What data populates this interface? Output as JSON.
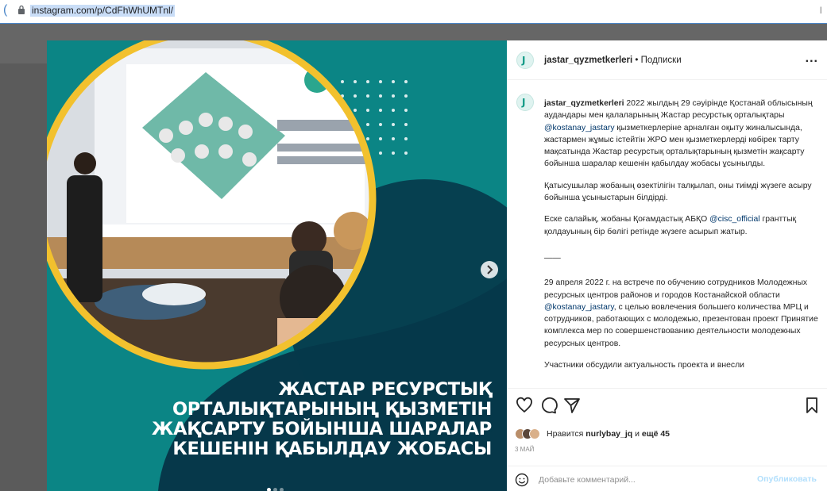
{
  "browser": {
    "url": "instagram.com/p/CdFhWhUMTnl/",
    "right_glyph": "I"
  },
  "post": {
    "author": "jastar_qyzmetkerleri",
    "separator": " • ",
    "follow_status": "Подписки",
    "more_label": "...",
    "headline_lines": [
      "ЖАСТАР РЕСУРСТЫҚ",
      "ОРТАЛЫҚТАРЫНЫҢ ҚЫЗМЕТІН",
      "ЖАҚСАРТУ БОЙЫНША ШАРАЛАР",
      "КЕШЕНІН ҚАБЫЛДАУ ЖОБАСЫ"
    ],
    "slide_dots": 3,
    "active_slide": 1,
    "caption": {
      "p1_text": " 2022 жылдың 29 сәуірінде Қостанай облысының аудандары мен қалаларының Жастар ресурстық орталықтары ",
      "p1_mention": "@kostanay_jastary",
      "p1_rest": " қызметкерлеріне арналған оқыту жиналысында, жастармен жұмыс істейтін ЖРО мен қызметкерлерді көбірек тарту мақсатында Жастар ресурстық орталықтарының қызметін жақсарту бойынша шаралар кешенін қабылдау жобасы ұсынылды.",
      "p2": "Қатысушылар жобаның өзектілігін талқылап, оны тиімді жүзеге асыру бойынша ұсыныстарын білдірді.",
      "p3_text": "Еске салайық, жобаны Қоғамдастық АБҚО ",
      "p3_mention": "@cisc_official",
      "p3_rest": " гранттық қолдауының бір бөлігі ретінде жүзеге асырып жатыр.",
      "divider": "——",
      "p4_text": "29 апреля 2022 г. на встрече по обучению сотрудников Молодежных ресурсных центров районов и городов Костанайской области ",
      "p4_mention": "@kostanay_jastary",
      "p4_rest": ", с целью вовлечения большего количества МРЦ и сотрудников, работающих с молодежью, презентован проект Принятие комплекса мер по совершенствованию деятельности молодежных ресурсных центров.",
      "p5": "Участники обсудили актуальность проекта и внесли"
    },
    "likes": {
      "prefix": "Нравится ",
      "user": "nurlybay_jq",
      "middle": " и ",
      "others": "ещё 45"
    },
    "date": "3 МАЙ",
    "comment_placeholder": "Добавьте комментарий...",
    "publish_label": "Опубликовать"
  },
  "colors": {
    "teal": "#0b8585",
    "dark_teal": "#06384a",
    "yellow": "#f2c12e",
    "publish_disabled": "#b2dffc"
  },
  "icons": [
    "back-arrow-icon",
    "lock-icon",
    "avatar-logo-icon",
    "more-icon",
    "heart-icon",
    "comment-icon",
    "share-icon",
    "bookmark-icon",
    "emoji-icon",
    "next-slide-icon"
  ]
}
